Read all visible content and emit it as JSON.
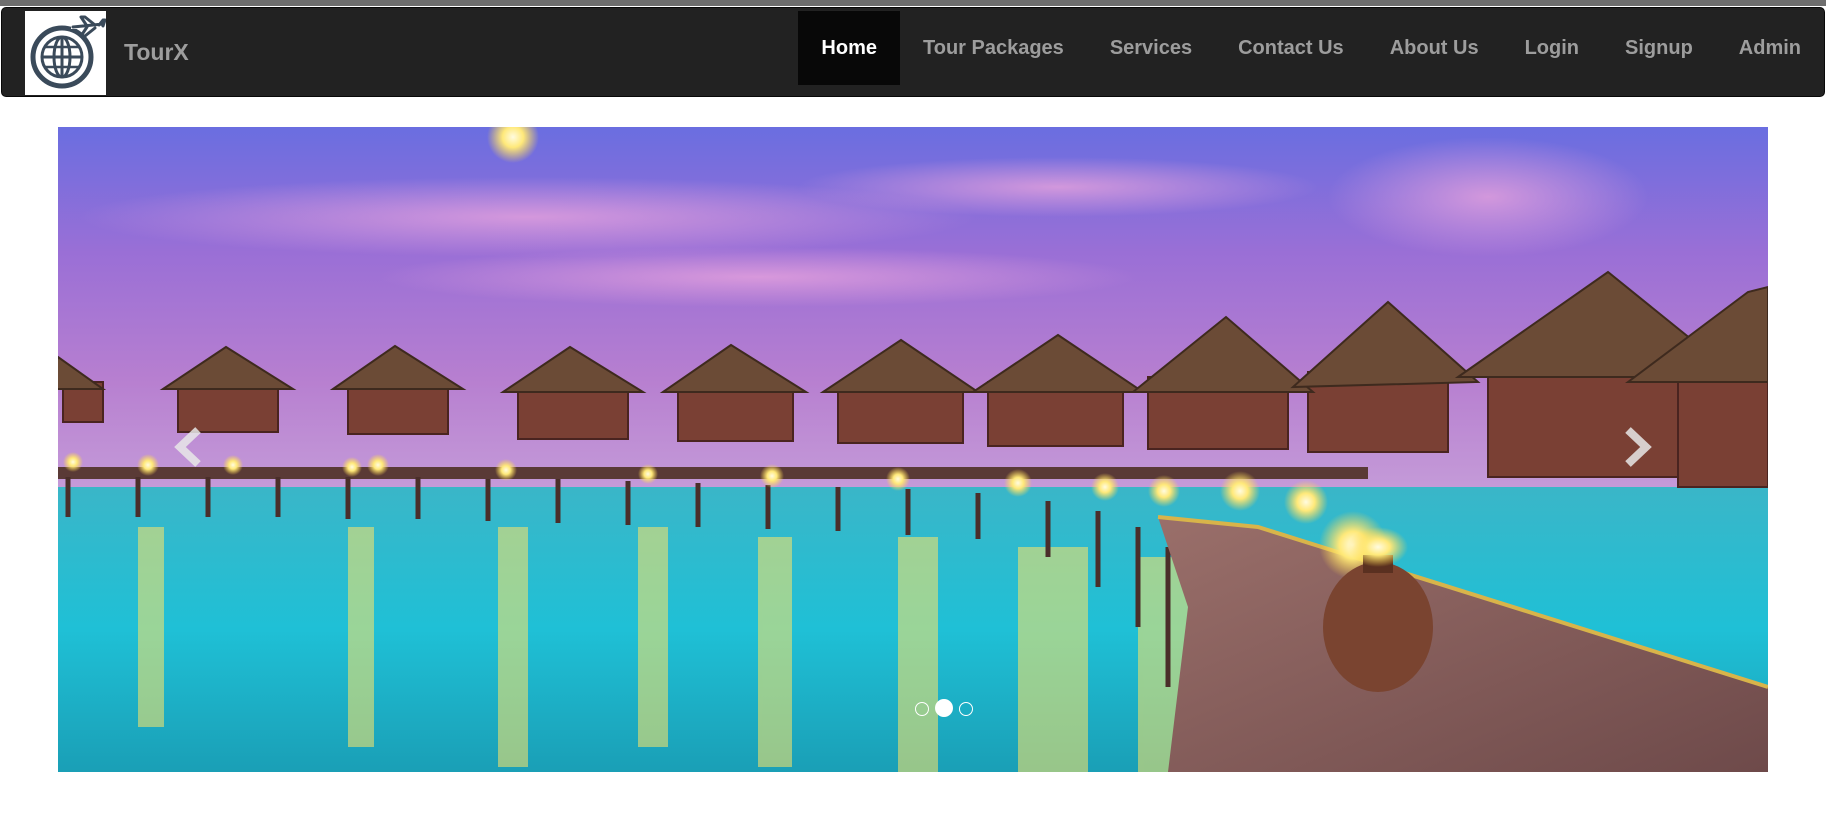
{
  "brand": {
    "name": "TourX",
    "logo_icon": "globe-plane-icon"
  },
  "nav": {
    "items": [
      {
        "label": "Home",
        "active": true
      },
      {
        "label": "Tour Packages",
        "active": false
      },
      {
        "label": "Services",
        "active": false
      },
      {
        "label": "Contact Us",
        "active": false
      },
      {
        "label": "About Us",
        "active": false
      },
      {
        "label": "Login",
        "active": false
      },
      {
        "label": "Signup",
        "active": false
      },
      {
        "label": "Admin",
        "active": false
      }
    ]
  },
  "carousel": {
    "slide_count": 3,
    "active_slide": 2,
    "prev_icon": "chevron-left-icon",
    "next_icon": "chevron-right-icon"
  },
  "colors": {
    "navbar_bg": "#222222",
    "nav_text": "#9d9d9d",
    "nav_active_text": "#ffffff",
    "nav_active_bg": "#080808"
  }
}
